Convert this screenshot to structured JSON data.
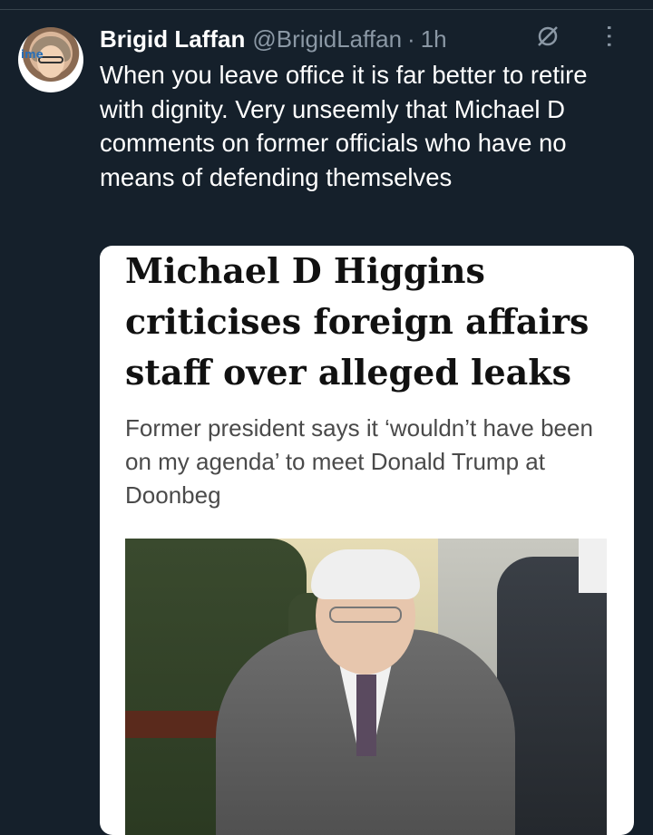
{
  "tweet": {
    "author_name": "Brigid Laffan",
    "author_handle": "@BrigidLaffan",
    "separator": "·",
    "time": "1h",
    "text": "When you leave office it is far better to retire with dignity. Very unseemly that Michael D comments on former officials who have no means of defending themselves"
  },
  "avatar": {
    "badge_text": "ime"
  },
  "card": {
    "headline": "Michael D Higgins criticises foreign affairs staff over alleged leaks",
    "subhead": "Former president says it ‘wouldn’t have been on my agenda’ to meet Donald Trump at Doonbeg"
  },
  "icons": {
    "grok": "grok-icon",
    "more": "more-icon"
  },
  "colors": {
    "background": "#15202b",
    "secondary_text": "#8b98a5",
    "primary_text": "#ffffff"
  }
}
